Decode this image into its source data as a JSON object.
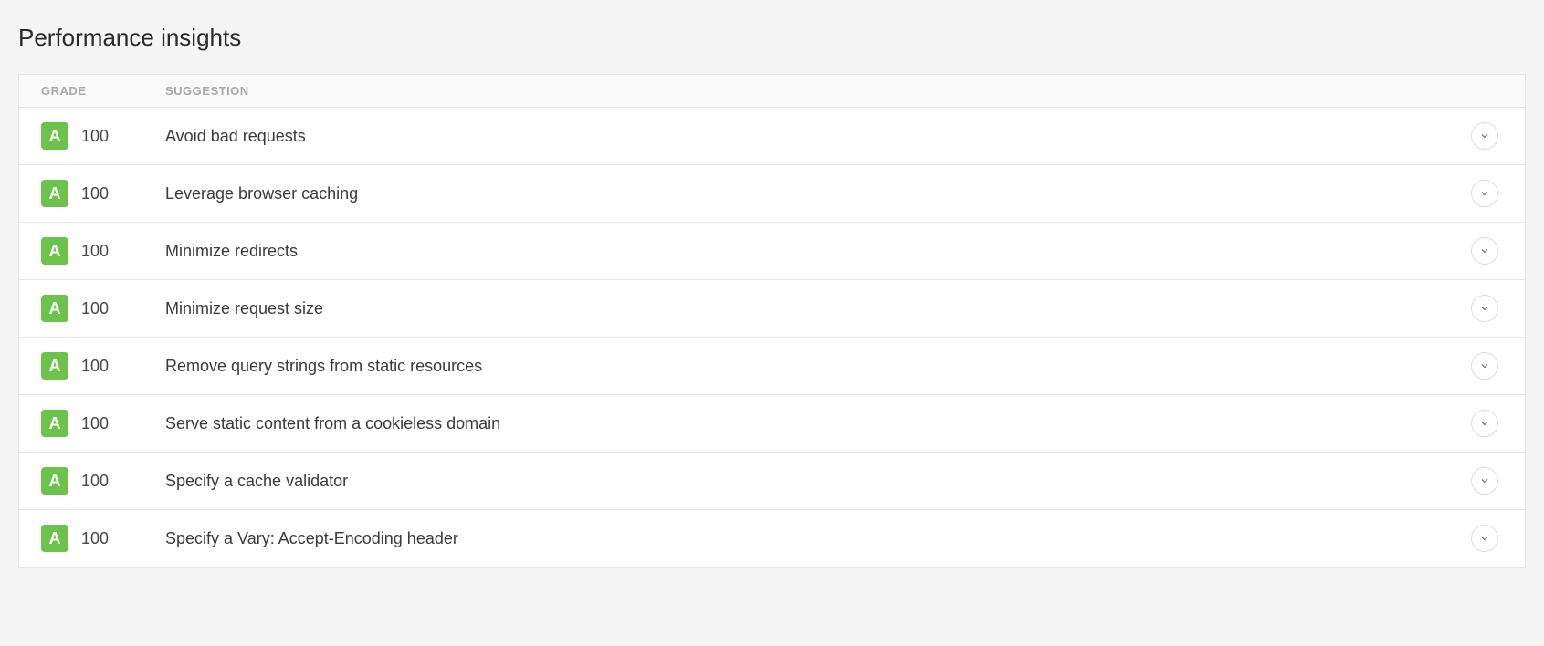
{
  "title": "Performance insights",
  "headers": {
    "grade": "GRADE",
    "suggestion": "SUGGESTION"
  },
  "rows": [
    {
      "grade_letter": "A",
      "grade_score": "100",
      "suggestion": "Avoid bad requests"
    },
    {
      "grade_letter": "A",
      "grade_score": "100",
      "suggestion": "Leverage browser caching"
    },
    {
      "grade_letter": "A",
      "grade_score": "100",
      "suggestion": "Minimize redirects"
    },
    {
      "grade_letter": "A",
      "grade_score": "100",
      "suggestion": "Minimize request size"
    },
    {
      "grade_letter": "A",
      "grade_score": "100",
      "suggestion": "Remove query strings from static resources"
    },
    {
      "grade_letter": "A",
      "grade_score": "100",
      "suggestion": "Serve static content from a cookieless domain"
    },
    {
      "grade_letter": "A",
      "grade_score": "100",
      "suggestion": "Specify a cache validator"
    },
    {
      "grade_letter": "A",
      "grade_score": "100",
      "suggestion": "Specify a Vary: Accept-Encoding header"
    }
  ]
}
